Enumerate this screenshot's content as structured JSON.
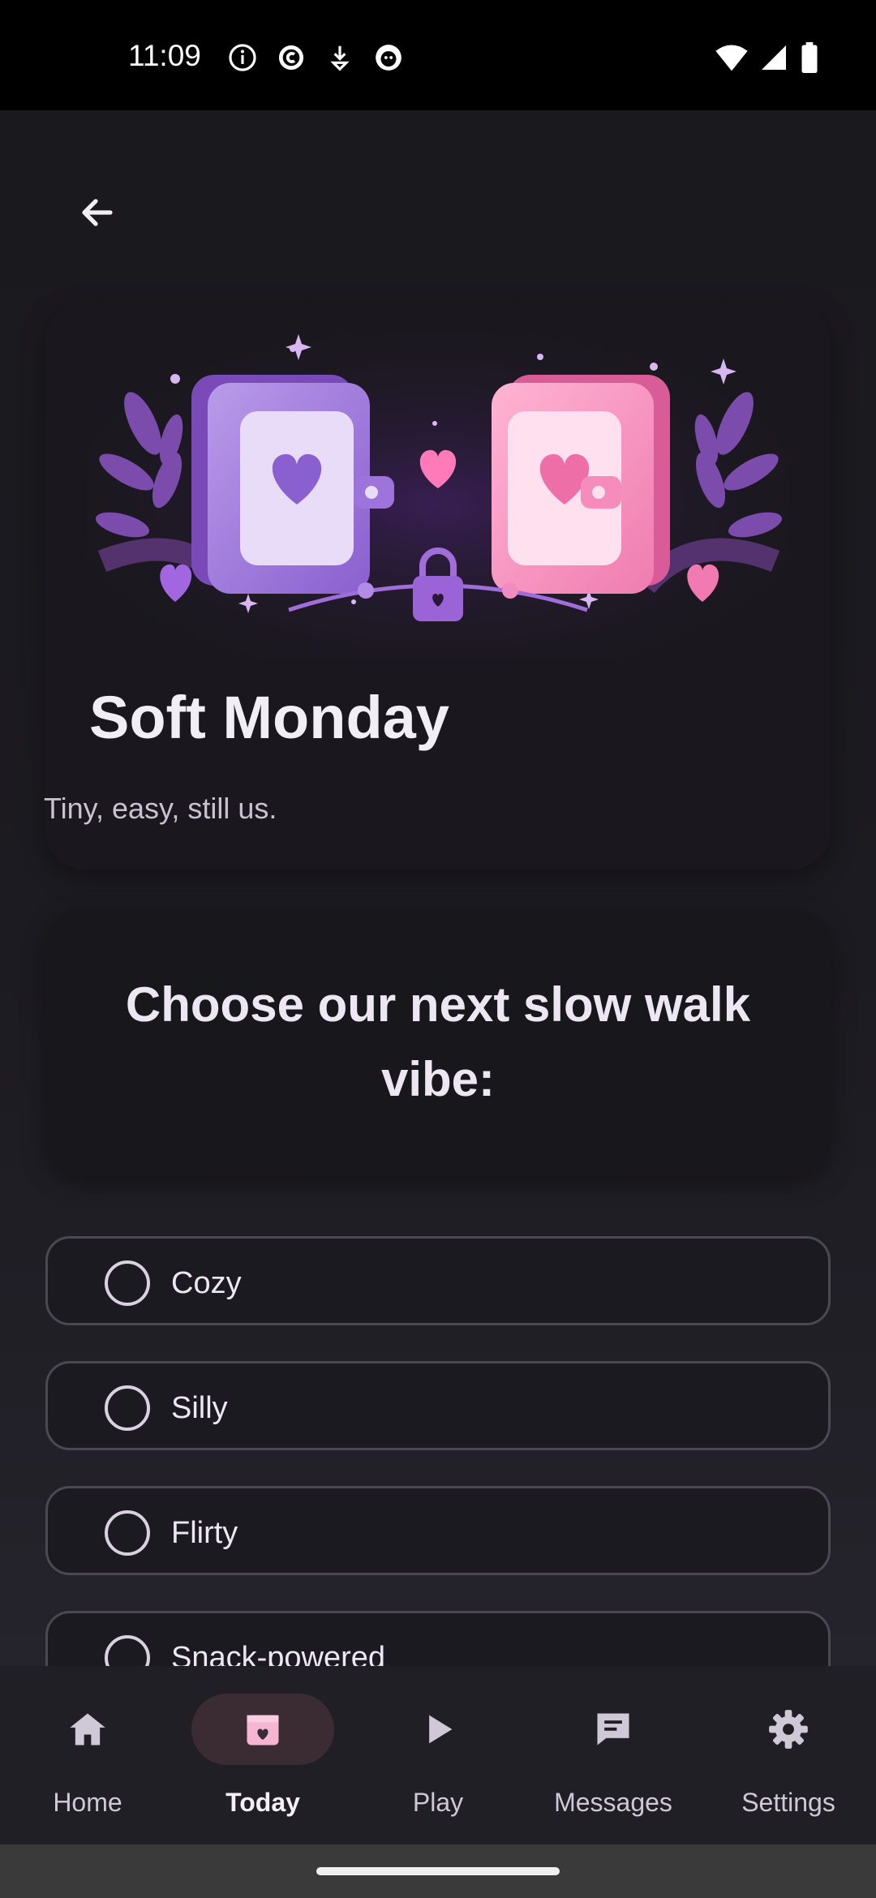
{
  "status_bar": {
    "time": "11:09",
    "left_icons": [
      "info-icon",
      "copyright-icon",
      "download-icon",
      "face-icon"
    ],
    "right_icons": [
      "wifi-icon",
      "signal-icon",
      "battery-icon"
    ]
  },
  "header": {
    "back_icon": "arrow-left-icon"
  },
  "hero": {
    "title": "Soft Monday",
    "subtitle": "Tiny, easy, still us."
  },
  "question": {
    "text": "Choose our next slow walk vibe:"
  },
  "options": [
    {
      "label": "Cozy",
      "selected": false
    },
    {
      "label": "Silly",
      "selected": false
    },
    {
      "label": "Flirty",
      "selected": false
    },
    {
      "label": "Snack-powered",
      "selected": false
    }
  ],
  "bottom_nav": {
    "active": "Today",
    "items": [
      {
        "label": "Home",
        "icon": "home-icon"
      },
      {
        "label": "Today",
        "icon": "calendar-heart-icon"
      },
      {
        "label": "Play",
        "icon": "play-icon"
      },
      {
        "label": "Messages",
        "icon": "message-icon"
      },
      {
        "label": "Settings",
        "icon": "gear-icon"
      }
    ]
  },
  "colors": {
    "background": "#1b1a20",
    "card": "#1a181e",
    "text": "#ece7f2",
    "accent_purple": "#9b6fd6",
    "accent_pink": "#f07cb3",
    "nav_active_pill": "#3b2b33"
  }
}
